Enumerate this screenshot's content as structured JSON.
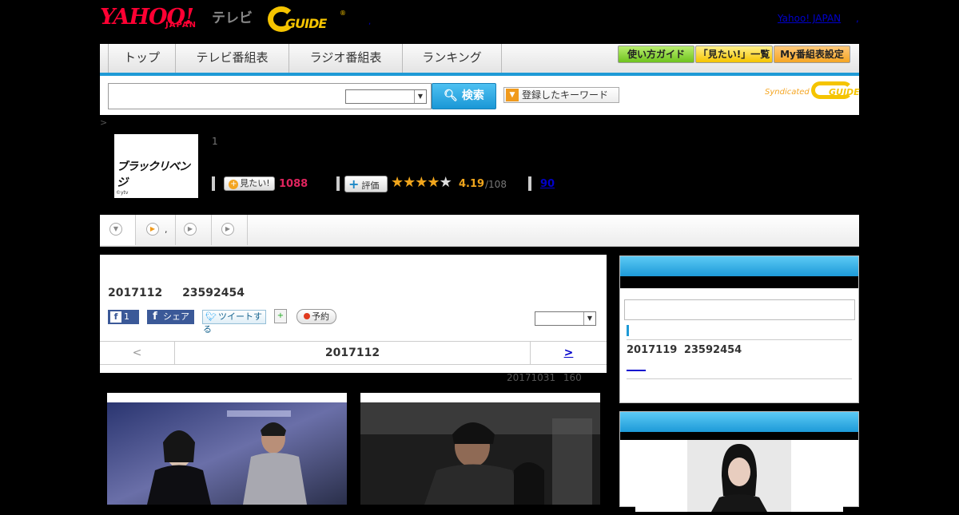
{
  "header": {
    "yahoo_logo": "YAHOO!",
    "japan_logo": "JAPAN",
    "tv_logo": "テレビ",
    "gguide_logo": "GUIDE",
    "reg_mark": "®",
    "dot": ",",
    "yahoo_japan_link": "Yahoo! JAPAN",
    "yahoo_japan_dot": ","
  },
  "nav": {
    "tabs": [
      {
        "label": "トップ"
      },
      {
        "label": "テレビ番組表"
      },
      {
        "label": "ラジオ番組表"
      },
      {
        "label": "ランキング"
      }
    ],
    "buttons": [
      {
        "label": "使い方ガイド",
        "color": "#7ed321"
      },
      {
        "label": "「見たい!」一覧",
        "color": "#f5c400"
      },
      {
        "label": "My番組表設定",
        "color": "#f5a623"
      }
    ]
  },
  "search": {
    "query": "",
    "search_button": "検索",
    "keyword_button": "登録したキーワード",
    "syndicated": "Syndicated",
    "syndicated_logo": "GUIDE"
  },
  "breadcrumb": ">",
  "program": {
    "logo_text": "ブラックリベンジ",
    "copyright": "©ytv",
    "line1": "1",
    "want_label": "見たい!",
    "want_count": "1088",
    "eval_label": "評価",
    "rating": "4.19",
    "rating_total": "/108",
    "reviews": "90",
    "stars_on": 4,
    "accent": "#e0245e"
  },
  "subtabs": [
    ",",
    "",
    ""
  ],
  "episode": {
    "title": "2017112 23592454",
    "fb_count": "1",
    "share_label": "シェア",
    "tweet_label": "ツイートする",
    "reserve_label": "予約",
    "prev": "<",
    "date": "2017112",
    "next": ">",
    "meta": "20171031 160"
  },
  "sidebar": {
    "episode": "2017119 23592454",
    "link": "____"
  }
}
